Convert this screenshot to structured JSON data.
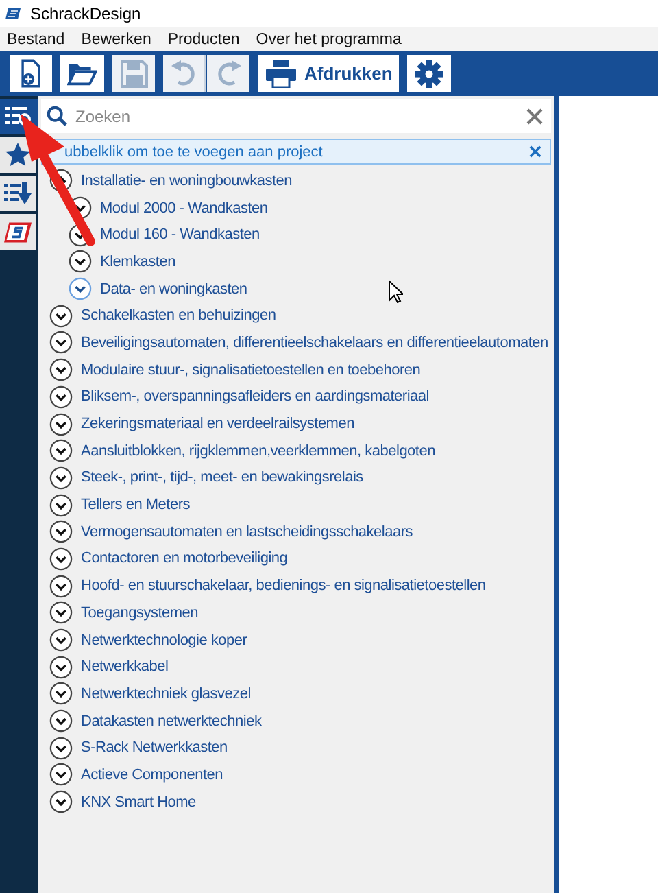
{
  "window": {
    "title": "SchrackDesign"
  },
  "menu": [
    "Bestand",
    "Bewerken",
    "Producten",
    "Over het programma"
  ],
  "toolbar": [
    {
      "kind": "new",
      "disabled": false
    },
    {
      "kind": "open",
      "disabled": false
    },
    {
      "kind": "save",
      "disabled": true
    },
    {
      "kind": "undo",
      "disabled": true
    },
    {
      "kind": "redo",
      "disabled": true
    },
    {
      "kind": "print",
      "label": "Afdrukken",
      "disabled": false
    },
    {
      "kind": "settings",
      "disabled": false
    }
  ],
  "sidebar": {
    "items": [
      {
        "kind": "catalog",
        "selected": true
      },
      {
        "kind": "favorites",
        "selected": false
      },
      {
        "kind": "import",
        "selected": false
      },
      {
        "kind": "logo",
        "selected": false
      }
    ]
  },
  "search": {
    "placeholder": "Zoeken"
  },
  "hint": "ubbelklik om toe te voegen aan project",
  "tree": [
    {
      "label": "Installatie- en woningbouwkasten",
      "expanded": true,
      "hovered": false,
      "children": [
        {
          "label": "Modul 2000 - Wandkasten",
          "expanded": false,
          "hovered": false
        },
        {
          "label": "Modul 160 - Wandkasten",
          "expanded": false,
          "hovered": false
        },
        {
          "label": "Klemkasten",
          "expanded": false,
          "hovered": false
        },
        {
          "label": "Data- en woningkasten",
          "expanded": false,
          "hovered": true
        }
      ]
    },
    {
      "label": "Schakelkasten en behuizingen",
      "expanded": false,
      "hovered": false
    },
    {
      "label": "Beveiligingsautomaten, differentieelschakelaars en differentieelautomaten",
      "expanded": false,
      "hovered": false
    },
    {
      "label": "Modulaire stuur-, signalisatietoestellen en toebehoren",
      "expanded": false,
      "hovered": false
    },
    {
      "label": "Bliksem-, overspanningsafleiders en aardingsmateriaal",
      "expanded": false,
      "hovered": false
    },
    {
      "label": "Zekeringsmateriaal en verdeelrailsystemen",
      "expanded": false,
      "hovered": false
    },
    {
      "label": "Aansluitblokken, rijgklemmen,veerklemmen, kabelgoten",
      "expanded": false,
      "hovered": false
    },
    {
      "label": "Steek-, print-, tijd-, meet- en bewakingsrelais",
      "expanded": false,
      "hovered": false
    },
    {
      "label": "Tellers en Meters",
      "expanded": false,
      "hovered": false
    },
    {
      "label": "Vermogensautomaten en lastscheidingsschakelaars",
      "expanded": false,
      "hovered": false
    },
    {
      "label": "Contactoren en motorbeveiliging",
      "expanded": false,
      "hovered": false
    },
    {
      "label": "Hoofd- en stuurschakelaar, bedienings- en signalisatietoestellen",
      "expanded": false,
      "hovered": false
    },
    {
      "label": "Toegangsystemen",
      "expanded": false,
      "hovered": false
    },
    {
      "label": "Netwerktechnologie koper",
      "expanded": false,
      "hovered": false
    },
    {
      "label": "Netwerkkabel",
      "expanded": false,
      "hovered": false
    },
    {
      "label": "Netwerktechniek glasvezel",
      "expanded": false,
      "hovered": false
    },
    {
      "label": "Datakasten netwerktechniek",
      "expanded": false,
      "hovered": false
    },
    {
      "label": "S-Rack Netwerkkasten",
      "expanded": false,
      "hovered": false
    },
    {
      "label": "Actieve Componenten",
      "expanded": false,
      "hovered": false
    },
    {
      "label": "KNX Smart Home",
      "expanded": false,
      "hovered": false
    }
  ]
}
